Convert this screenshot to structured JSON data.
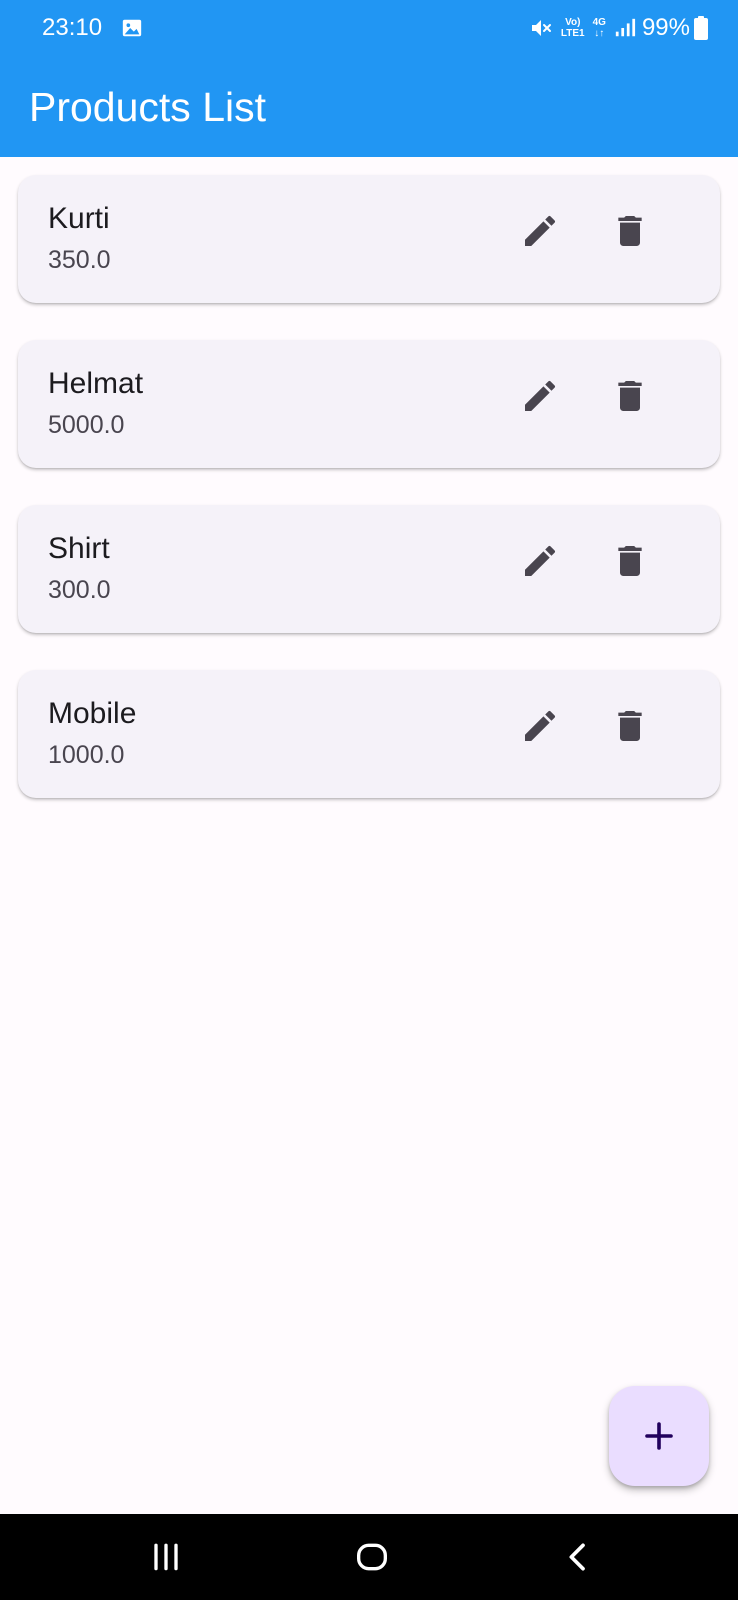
{
  "status_bar": {
    "time": "23:10",
    "volte_top": "Vo)",
    "volte_bottom": "LTE1",
    "network_top": "4G",
    "network_bottom": "↓↑",
    "battery": "99%",
    "icons": [
      "gallery-icon",
      "mute-icon",
      "signal-icon",
      "battery-icon"
    ]
  },
  "app_bar": {
    "title": "Products List",
    "color": "#2196f3"
  },
  "products": [
    {
      "name": "Kurti",
      "price": "350.0"
    },
    {
      "name": "Helmat",
      "price": "5000.0"
    },
    {
      "name": "Shirt",
      "price": "300.0"
    },
    {
      "name": "Mobile",
      "price": "1000.0"
    }
  ],
  "item_icons": [
    "edit-icon",
    "delete-icon"
  ],
  "fab": {
    "icon": "plus-icon",
    "color": "#eaddff"
  },
  "nav_bar": {
    "icons": [
      "recents-icon",
      "home-icon",
      "back-icon"
    ]
  },
  "colors": {
    "card_background": "#f5f2f9",
    "page_background": "#fffbfe",
    "icon_color": "#49454f"
  }
}
